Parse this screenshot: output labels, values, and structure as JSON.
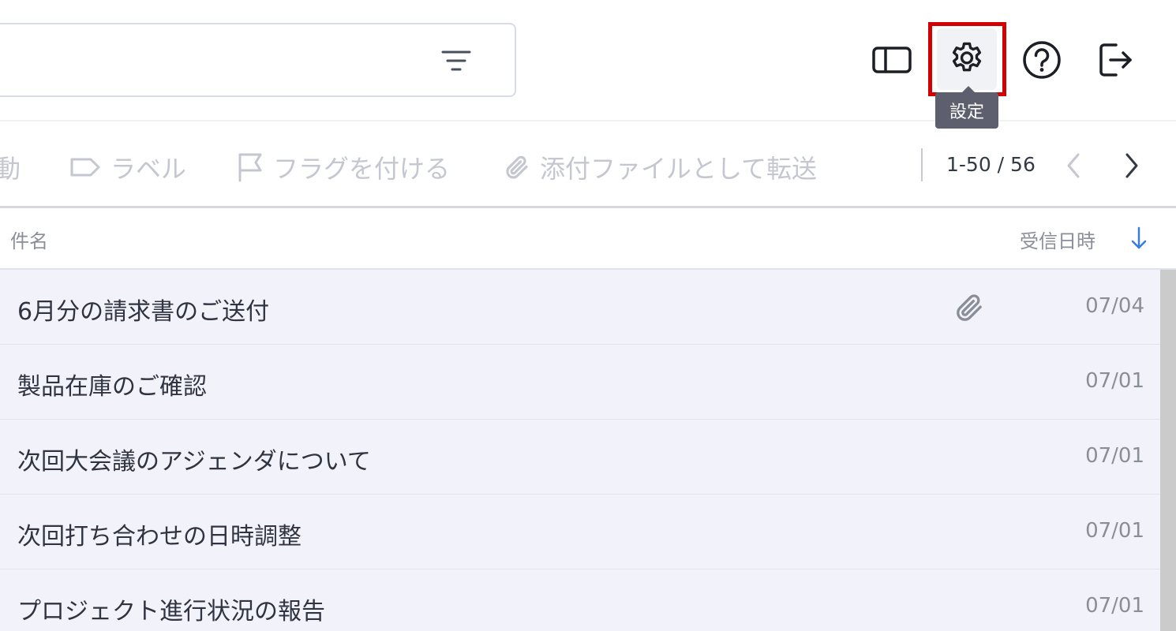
{
  "header": {
    "tooltip": "設定",
    "icons": [
      "filter-icon",
      "layout-toggle-icon",
      "gear-icon",
      "help-icon",
      "logout-icon"
    ]
  },
  "toolbar": {
    "move_label": "動",
    "label_label": "ラベル",
    "flag_label": "フラグを付ける",
    "forward_label": "添付ファイルとして転送",
    "pager_text": "1-50 / 56"
  },
  "columns": {
    "subject": "件名",
    "received": "受信日時"
  },
  "emails": [
    {
      "subject": "6月分の請求書のご送付",
      "date": "07/04",
      "has_attachment": true
    },
    {
      "subject": "製品在庫のご確認",
      "date": "07/01",
      "has_attachment": false
    },
    {
      "subject": "次回大会議のアジェンダについて",
      "date": "07/01",
      "has_attachment": false
    },
    {
      "subject": "次回打ち合わせの日時調整",
      "date": "07/01",
      "has_attachment": false
    },
    {
      "subject": "プロジェクト進行状況の報告",
      "date": "07/01",
      "has_attachment": false
    }
  ],
  "colors": {
    "highlight": "#d20000",
    "tooltip_bg": "#5d5f6e",
    "list_bg": "#f2f3fa",
    "sort_arrow": "#3a7be0",
    "disabled_text": "#c5c7d0"
  }
}
